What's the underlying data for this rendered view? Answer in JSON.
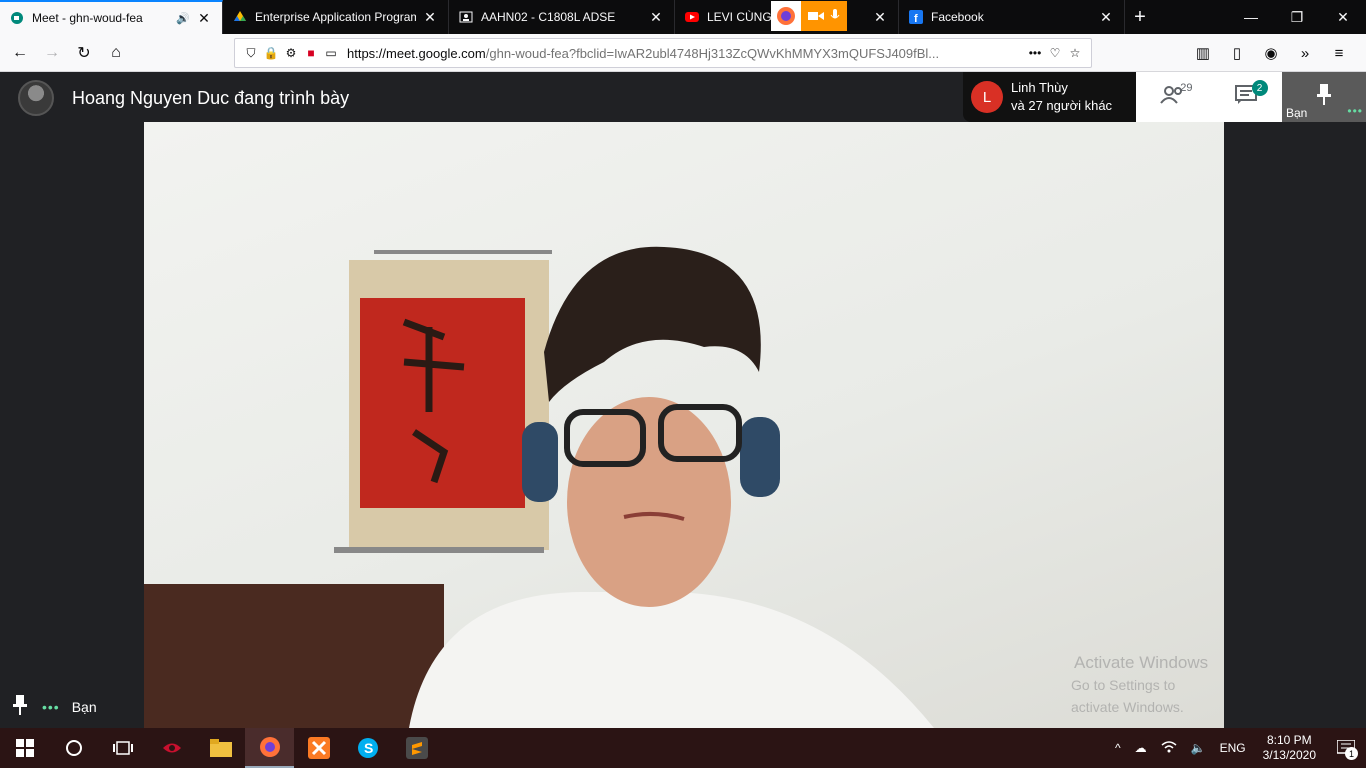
{
  "browser": {
    "tabs": [
      {
        "title": "Meet - ghn-woud-fea",
        "icon": "google-meet-icon",
        "active": true,
        "audio": true
      },
      {
        "title": "Enterprise Application Programming",
        "icon": "google-drive-icon",
        "active": false
      },
      {
        "title": "AAHN02 - C1808L ADSE",
        "icon": "classroom-icon",
        "active": false
      },
      {
        "title": "LEVI CÙNG DÂN NHẠC",
        "icon": "youtube-icon",
        "active": false
      },
      {
        "title": "Facebook",
        "icon": "facebook-icon",
        "active": false
      }
    ],
    "url_domain": "https://meet.google.com",
    "url_rest": "/ghn-woud-fea?fbclid=IwAR2ubl4748Hj313ZcQWvKhMMYX3mQUFSJ409fBl..."
  },
  "meet": {
    "presenter_text": "Hoang Nguyen Duc đang trình bày",
    "speaker_letter": "L",
    "speaker_name": "Linh Thùy",
    "speaker_others": "và 27 người khác",
    "participant_count": "29",
    "chat_badge": "2",
    "self_label": "Bạn",
    "bottom_self_label": "Bạn"
  },
  "watermark": {
    "line1": "Activate Windows",
    "line2": "Go to Settings to activate Windows."
  },
  "taskbar": {
    "language": "ENG",
    "time": "8:10 PM",
    "date": "3/13/2020",
    "notification_count": "1"
  },
  "colors": {
    "meet_bg": "#202124",
    "speaker_avatar": "#d93025",
    "chat_badge": "#00897b",
    "taskbar": "#2b1414",
    "tab_accent": "#0a84ff"
  }
}
